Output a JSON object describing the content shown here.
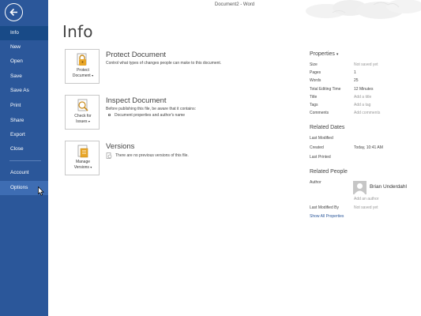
{
  "window": {
    "title": "Document2 - Word"
  },
  "sidebar": {
    "items": [
      {
        "label": "Info"
      },
      {
        "label": "New"
      },
      {
        "label": "Open"
      },
      {
        "label": "Save"
      },
      {
        "label": "Save As"
      },
      {
        "label": "Print"
      },
      {
        "label": "Share"
      },
      {
        "label": "Export"
      },
      {
        "label": "Close"
      },
      {
        "label": "Account"
      },
      {
        "label": "Options"
      }
    ],
    "accent": "#2b579a"
  },
  "page": {
    "title": "Info"
  },
  "sections": {
    "protect": {
      "button_line1": "Protect",
      "button_line2": "Document",
      "title": "Protect Document",
      "description": "Control what types of changes people can make to this document."
    },
    "inspect": {
      "button_line1": "Check for",
      "button_line2": "Issues",
      "title": "Inspect Document",
      "description": "Before publishing this file, be aware that it contains:",
      "bullet": "Document properties and author's name"
    },
    "versions": {
      "button_line1": "Manage",
      "button_line2": "Versions",
      "title": "Versions",
      "description": "There are no previous versions of this file."
    }
  },
  "properties": {
    "title": "Properties",
    "rows": [
      {
        "label": "Size",
        "value": "Not saved yet"
      },
      {
        "label": "Pages",
        "value": "1"
      },
      {
        "label": "Words",
        "value": "25"
      },
      {
        "label": "Total Editing Time",
        "value": "12 Minutes"
      },
      {
        "label": "Title",
        "value": "Add a title"
      },
      {
        "label": "Tags",
        "value": "Add a tag"
      },
      {
        "label": "Comments",
        "value": "Add comments"
      }
    ]
  },
  "related_dates": {
    "title": "Related Dates",
    "rows": [
      {
        "label": "Last Modified",
        "value": ""
      },
      {
        "label": "Created",
        "value": "Today, 10:41 AM"
      },
      {
        "label": "Last Printed",
        "value": ""
      }
    ]
  },
  "related_people": {
    "title": "Related People",
    "author_label": "Author",
    "author_name": "Brian Underdahl",
    "add_author": "Add an author",
    "last_modified_by_label": "Last Modified By",
    "last_modified_by_value": "Not saved yet"
  },
  "show_all": "Show All Properties"
}
